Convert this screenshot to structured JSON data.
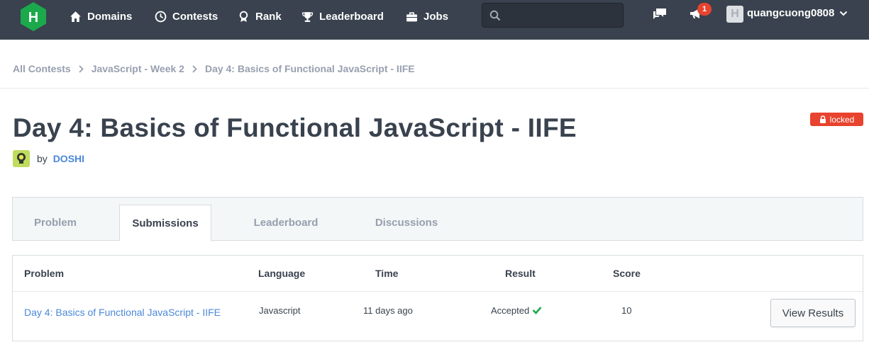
{
  "nav": {
    "logo_letter": "H",
    "items": [
      {
        "label": "Domains",
        "icon": "home-icon"
      },
      {
        "label": "Contests",
        "icon": "clock-icon"
      },
      {
        "label": "Rank",
        "icon": "medal-icon"
      },
      {
        "label": "Leaderboard",
        "icon": "trophy-icon"
      },
      {
        "label": "Jobs",
        "icon": "briefcase-icon"
      }
    ],
    "search_placeholder": "",
    "notification_count": "1",
    "avatar_letter": "H",
    "username": "quangcuong0808"
  },
  "breadcrumb": [
    "All Contests",
    "JavaScript - Week 2",
    "Day 4: Basics of Functional JavaScript - IIFE"
  ],
  "page": {
    "title": "Day 4: Basics of Functional JavaScript - IIFE",
    "status": "locked",
    "by_label": "by",
    "author": "DOSHI"
  },
  "tabs": [
    "Problem",
    "Submissions",
    "Leaderboard",
    "Discussions"
  ],
  "active_tab": "Submissions",
  "table": {
    "headers": [
      "Problem",
      "Language",
      "Time",
      "Result",
      "Score"
    ],
    "rows": [
      {
        "problem": "Day 4: Basics of Functional JavaScript - IIFE",
        "language": "Javascript",
        "time": "11 days ago",
        "result": "Accepted",
        "score": "10",
        "action": "View Results"
      }
    ]
  },
  "colors": {
    "navbar": "#39424e",
    "brand_green": "#1ba94c",
    "link_blue": "#4a88d9",
    "danger": "#e8432e"
  }
}
